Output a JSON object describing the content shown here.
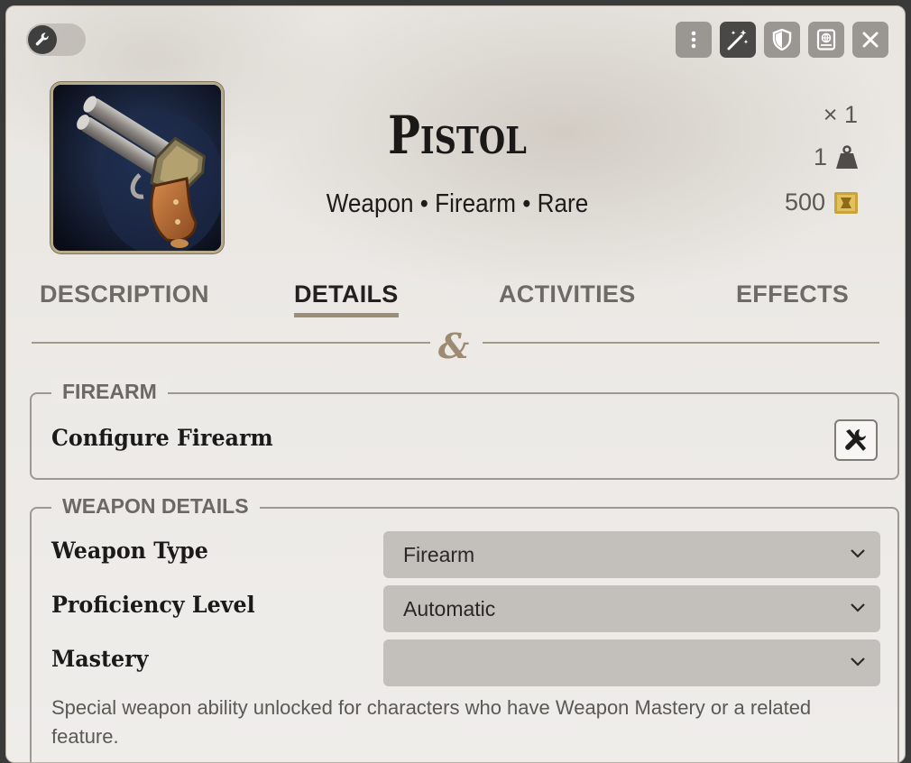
{
  "header": {
    "buttons": [
      "more-options",
      "magic-wand",
      "shield",
      "compendium",
      "close"
    ]
  },
  "item": {
    "name": "Pistol",
    "subtitle": "Weapon • Firearm • Rare",
    "quantity": "× 1",
    "weight": "1",
    "price": "500"
  },
  "tabs": [
    {
      "label": "DESCRIPTION",
      "active": false
    },
    {
      "label": "DETAILS",
      "active": true
    },
    {
      "label": "ACTIVITIES",
      "active": false
    },
    {
      "label": "EFFECTS",
      "active": false
    }
  ],
  "firearm": {
    "legend": "FIREARM",
    "configure_label": "Configure Firearm"
  },
  "weapon_details": {
    "legend": "WEAPON DETAILS",
    "weapon_type": {
      "label": "Weapon Type",
      "value": "Firearm"
    },
    "proficiency": {
      "label": "Proficiency Level",
      "value": "Automatic"
    },
    "mastery": {
      "label": "Mastery",
      "value": ""
    },
    "mastery_hint": "Special weapon ability unlocked for characters who have Weapon Mastery or a related feature."
  },
  "colors": {
    "accent": "#9b8f78",
    "button_bg": "#9a9692",
    "select_bg": "#c3bfbb"
  }
}
